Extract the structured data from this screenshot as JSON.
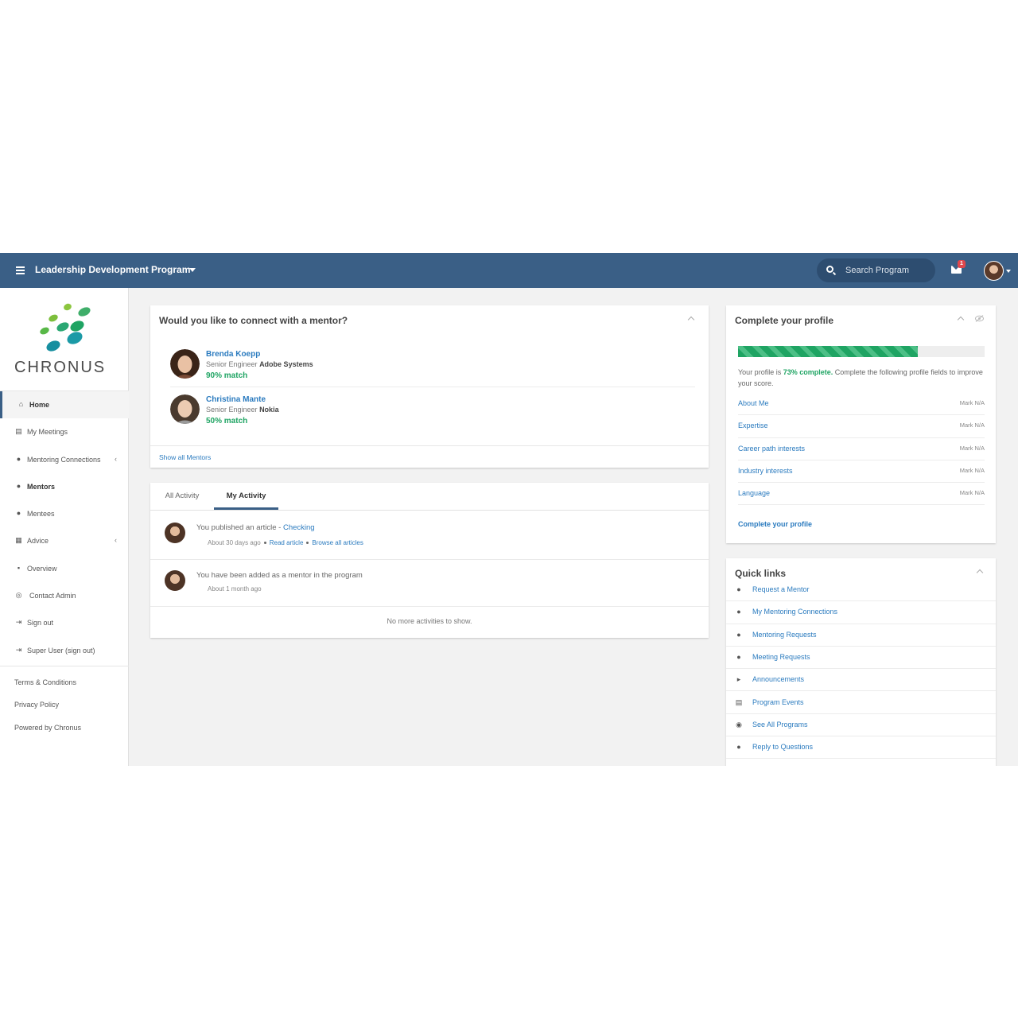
{
  "topbar": {
    "program_title": "Leadership Development Program",
    "search_placeholder": "Search Program",
    "mail_badge": "1",
    "colors": {
      "bar": "#3a5f86",
      "search_bg": "#2d4d70",
      "badge": "#e0474c"
    }
  },
  "sidebar": {
    "logo_text": "CHRONUS",
    "nav": [
      {
        "label": "Home",
        "icon": "home-icon",
        "active": true
      },
      {
        "label": "My Meetings",
        "icon": "calendar-icon"
      },
      {
        "label": "Mentoring Connections",
        "icon": "users-icon",
        "has_chevron": true
      },
      {
        "label": "Mentors",
        "icon": "user-icon",
        "bold": true
      },
      {
        "label": "Mentees",
        "icon": "user-icon"
      },
      {
        "label": "Advice",
        "icon": "document-icon",
        "has_chevron": true
      },
      {
        "label": "Overview",
        "icon": "file-icon"
      },
      {
        "label": "Contact Admin",
        "icon": "life-ring-icon"
      },
      {
        "label": "Sign out",
        "icon": "sign-out-icon"
      },
      {
        "label": "Super User (sign out)",
        "icon": "sign-out-icon"
      }
    ],
    "footer": [
      "Terms & Conditions",
      "Privacy Policy",
      "Powered by Chronus"
    ]
  },
  "mentor_card": {
    "title": "Would you like to connect with a mentor?",
    "mentors": [
      {
        "name": "Brenda Koepp",
        "role": "Senior Engineer",
        "company": "Adobe Systems",
        "match": "90% match"
      },
      {
        "name": "Christina Mante",
        "role": "Senior Engineer",
        "company": "Nokia",
        "match": "50% match"
      }
    ],
    "show_all": "Show all Mentors"
  },
  "activity_card": {
    "tabs": [
      "All Activity",
      "My Activity"
    ],
    "active_tab": "My Activity",
    "items": [
      {
        "text": "You published an article - ",
        "link": "Checking",
        "time": "About 30 days ago",
        "actions": [
          "Read article",
          "Browse all articles"
        ]
      },
      {
        "text": "You have been added as a mentor in the program",
        "time": "About 1 month ago"
      }
    ],
    "empty_text": "No more activities to show."
  },
  "profile_card": {
    "title": "Complete your profile",
    "progress_percent": 73,
    "desc_prefix": "Your profile is ",
    "desc_pct": "73% complete.",
    "desc_suffix": " Complete the following profile fields to improve your score.",
    "fields": [
      {
        "name": "About Me",
        "mark": "Mark N/A"
      },
      {
        "name": "Expertise",
        "mark": "Mark N/A"
      },
      {
        "name": "Career path interests",
        "mark": "Mark N/A"
      },
      {
        "name": "Industry interests",
        "mark": "Mark N/A"
      },
      {
        "name": "Language",
        "mark": "Mark N/A"
      }
    ],
    "cta": "Complete your profile",
    "accent": "#1fa463"
  },
  "quick_links": {
    "title": "Quick links",
    "items": [
      {
        "label": "Request a Mentor",
        "icon": "user-icon"
      },
      {
        "label": "My Mentoring Connections",
        "icon": "users-icon"
      },
      {
        "label": "Mentoring Requests",
        "icon": "user-plus-icon"
      },
      {
        "label": "Meeting Requests",
        "icon": "user-plus-icon"
      },
      {
        "label": "Announcements",
        "icon": "bullhorn-icon"
      },
      {
        "label": "Program Events",
        "icon": "calendar-icon"
      },
      {
        "label": "See All Programs",
        "icon": "globe-icon"
      },
      {
        "label": "Reply to Questions",
        "icon": "comment-icon"
      }
    ]
  }
}
